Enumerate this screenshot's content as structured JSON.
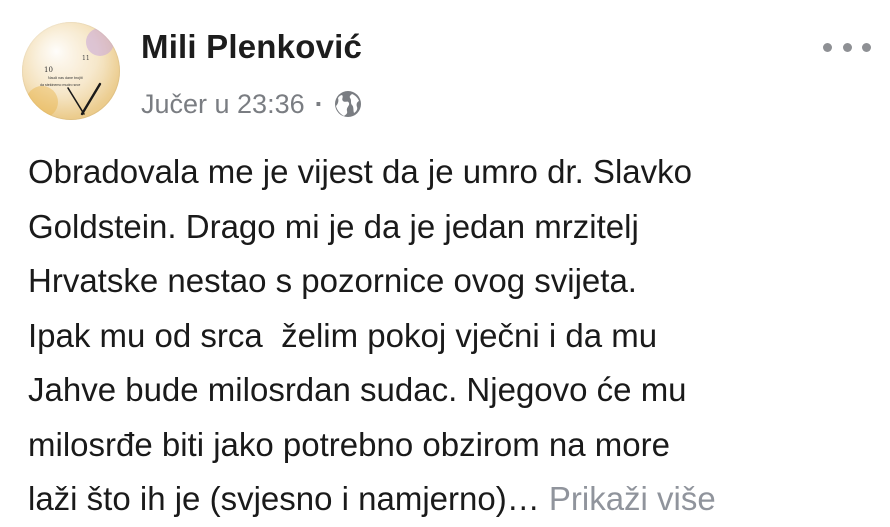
{
  "post": {
    "author": "Mili Plenković",
    "timestamp": "Jučer u 23:36",
    "separator": "·",
    "privacy_icon": "globe-icon",
    "more_icon": "more-options-icon",
    "avatar_text": {
      "digits": "10",
      "line1": "Nauči nas dane brojiti",
      "line2": "da stekinemo mudro srce"
    },
    "body_lines": [
      "Obradovala me je vijest da je umro dr. Slavko",
      "Goldstein. Drago mi je da je jedan mrzitelj",
      "Hrvatske nestao s pozornice ovog svijeta.",
      "Ipak mu od srca  želim pokoj vječni i da mu",
      "Jahve bude milosrdan sudac. Njegovo će mu",
      "milosrđe biti jako potrebno obzirom na more"
    ],
    "last_line": "laži što ih je (svjesno i namjerno)…",
    "see_more": "Prikaži više"
  },
  "colors": {
    "text": "#1a1a1a",
    "secondary": "#7a7d82",
    "see_more": "#90949c",
    "background": "#ffffff"
  }
}
